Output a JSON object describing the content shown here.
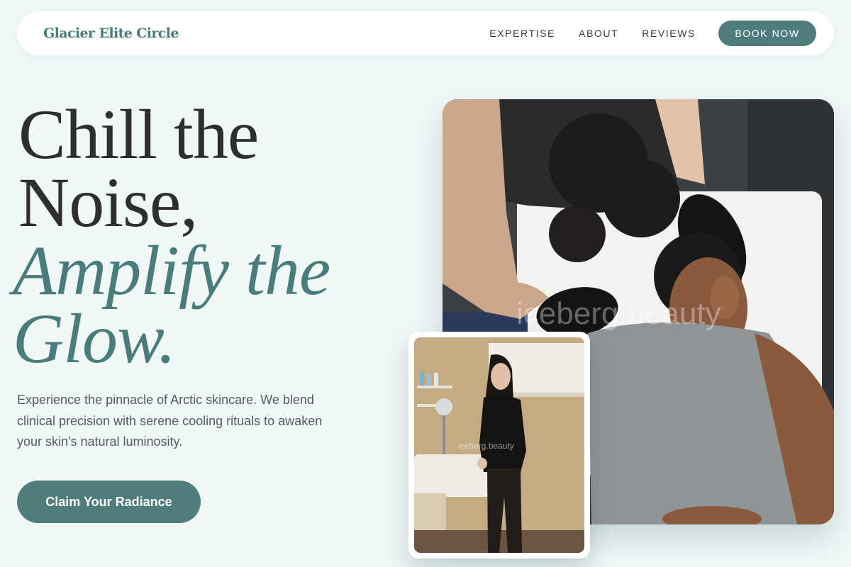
{
  "nav": {
    "brand": "Glacier Elite Circle",
    "links": [
      "EXPERTISE",
      "ABOUT",
      "REVIEWS"
    ],
    "book_label": "BOOK NOW"
  },
  "hero": {
    "title_line1": "Chill the",
    "title_line2": "Noise,",
    "title_line3": "Amplify the",
    "title_line4": "Glow.",
    "description": "Experience the pinnacle of Arctic skincare. We blend clinical precision with serene cooling rituals to awaken your skin's natural luminosity.",
    "cta_label": "Claim Your Radiance"
  },
  "images": {
    "main_watermark": "iceberg.beauty",
    "small_watermark": "iceberg.beauty"
  },
  "colors": {
    "accent": "#4f7d7c",
    "background": "#eff7f7",
    "heading": "#2e2e2e"
  }
}
